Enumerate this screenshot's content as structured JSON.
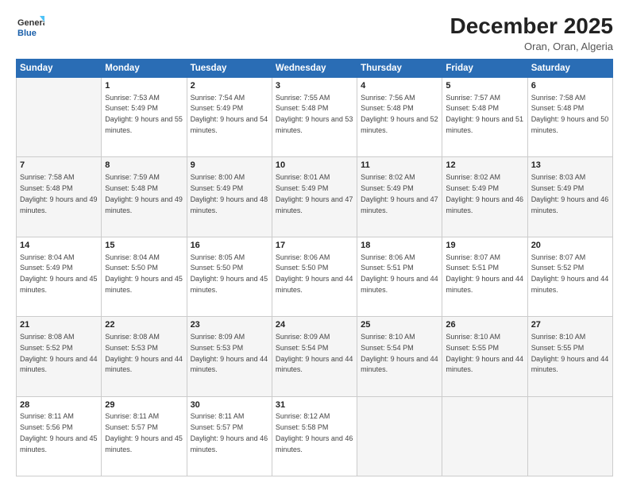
{
  "header": {
    "logo_line1": "General",
    "logo_line2": "Blue",
    "month": "December 2025",
    "location": "Oran, Oran, Algeria"
  },
  "weekdays": [
    "Sunday",
    "Monday",
    "Tuesday",
    "Wednesday",
    "Thursday",
    "Friday",
    "Saturday"
  ],
  "weeks": [
    [
      {
        "day": "",
        "sunrise": "",
        "sunset": "",
        "daylight": ""
      },
      {
        "day": "1",
        "sunrise": "7:53 AM",
        "sunset": "5:49 PM",
        "daylight": "9 hours and 55 minutes."
      },
      {
        "day": "2",
        "sunrise": "7:54 AM",
        "sunset": "5:49 PM",
        "daylight": "9 hours and 54 minutes."
      },
      {
        "day": "3",
        "sunrise": "7:55 AM",
        "sunset": "5:48 PM",
        "daylight": "9 hours and 53 minutes."
      },
      {
        "day": "4",
        "sunrise": "7:56 AM",
        "sunset": "5:48 PM",
        "daylight": "9 hours and 52 minutes."
      },
      {
        "day": "5",
        "sunrise": "7:57 AM",
        "sunset": "5:48 PM",
        "daylight": "9 hours and 51 minutes."
      },
      {
        "day": "6",
        "sunrise": "7:58 AM",
        "sunset": "5:48 PM",
        "daylight": "9 hours and 50 minutes."
      }
    ],
    [
      {
        "day": "7",
        "sunrise": "7:58 AM",
        "sunset": "5:48 PM",
        "daylight": "9 hours and 49 minutes."
      },
      {
        "day": "8",
        "sunrise": "7:59 AM",
        "sunset": "5:48 PM",
        "daylight": "9 hours and 49 minutes."
      },
      {
        "day": "9",
        "sunrise": "8:00 AM",
        "sunset": "5:49 PM",
        "daylight": "9 hours and 48 minutes."
      },
      {
        "day": "10",
        "sunrise": "8:01 AM",
        "sunset": "5:49 PM",
        "daylight": "9 hours and 47 minutes."
      },
      {
        "day": "11",
        "sunrise": "8:02 AM",
        "sunset": "5:49 PM",
        "daylight": "9 hours and 47 minutes."
      },
      {
        "day": "12",
        "sunrise": "8:02 AM",
        "sunset": "5:49 PM",
        "daylight": "9 hours and 46 minutes."
      },
      {
        "day": "13",
        "sunrise": "8:03 AM",
        "sunset": "5:49 PM",
        "daylight": "9 hours and 46 minutes."
      }
    ],
    [
      {
        "day": "14",
        "sunrise": "8:04 AM",
        "sunset": "5:49 PM",
        "daylight": "9 hours and 45 minutes."
      },
      {
        "day": "15",
        "sunrise": "8:04 AM",
        "sunset": "5:50 PM",
        "daylight": "9 hours and 45 minutes."
      },
      {
        "day": "16",
        "sunrise": "8:05 AM",
        "sunset": "5:50 PM",
        "daylight": "9 hours and 45 minutes."
      },
      {
        "day": "17",
        "sunrise": "8:06 AM",
        "sunset": "5:50 PM",
        "daylight": "9 hours and 44 minutes."
      },
      {
        "day": "18",
        "sunrise": "8:06 AM",
        "sunset": "5:51 PM",
        "daylight": "9 hours and 44 minutes."
      },
      {
        "day": "19",
        "sunrise": "8:07 AM",
        "sunset": "5:51 PM",
        "daylight": "9 hours and 44 minutes."
      },
      {
        "day": "20",
        "sunrise": "8:07 AM",
        "sunset": "5:52 PM",
        "daylight": "9 hours and 44 minutes."
      }
    ],
    [
      {
        "day": "21",
        "sunrise": "8:08 AM",
        "sunset": "5:52 PM",
        "daylight": "9 hours and 44 minutes."
      },
      {
        "day": "22",
        "sunrise": "8:08 AM",
        "sunset": "5:53 PM",
        "daylight": "9 hours and 44 minutes."
      },
      {
        "day": "23",
        "sunrise": "8:09 AM",
        "sunset": "5:53 PM",
        "daylight": "9 hours and 44 minutes."
      },
      {
        "day": "24",
        "sunrise": "8:09 AM",
        "sunset": "5:54 PM",
        "daylight": "9 hours and 44 minutes."
      },
      {
        "day": "25",
        "sunrise": "8:10 AM",
        "sunset": "5:54 PM",
        "daylight": "9 hours and 44 minutes."
      },
      {
        "day": "26",
        "sunrise": "8:10 AM",
        "sunset": "5:55 PM",
        "daylight": "9 hours and 44 minutes."
      },
      {
        "day": "27",
        "sunrise": "8:10 AM",
        "sunset": "5:55 PM",
        "daylight": "9 hours and 44 minutes."
      }
    ],
    [
      {
        "day": "28",
        "sunrise": "8:11 AM",
        "sunset": "5:56 PM",
        "daylight": "9 hours and 45 minutes."
      },
      {
        "day": "29",
        "sunrise": "8:11 AM",
        "sunset": "5:57 PM",
        "daylight": "9 hours and 45 minutes."
      },
      {
        "day": "30",
        "sunrise": "8:11 AM",
        "sunset": "5:57 PM",
        "daylight": "9 hours and 46 minutes."
      },
      {
        "day": "31",
        "sunrise": "8:12 AM",
        "sunset": "5:58 PM",
        "daylight": "9 hours and 46 minutes."
      },
      {
        "day": "",
        "sunrise": "",
        "sunset": "",
        "daylight": ""
      },
      {
        "day": "",
        "sunrise": "",
        "sunset": "",
        "daylight": ""
      },
      {
        "day": "",
        "sunrise": "",
        "sunset": "",
        "daylight": ""
      }
    ]
  ],
  "labels": {
    "sunrise_prefix": "Sunrise: ",
    "sunset_prefix": "Sunset: ",
    "daylight_prefix": "Daylight: "
  }
}
